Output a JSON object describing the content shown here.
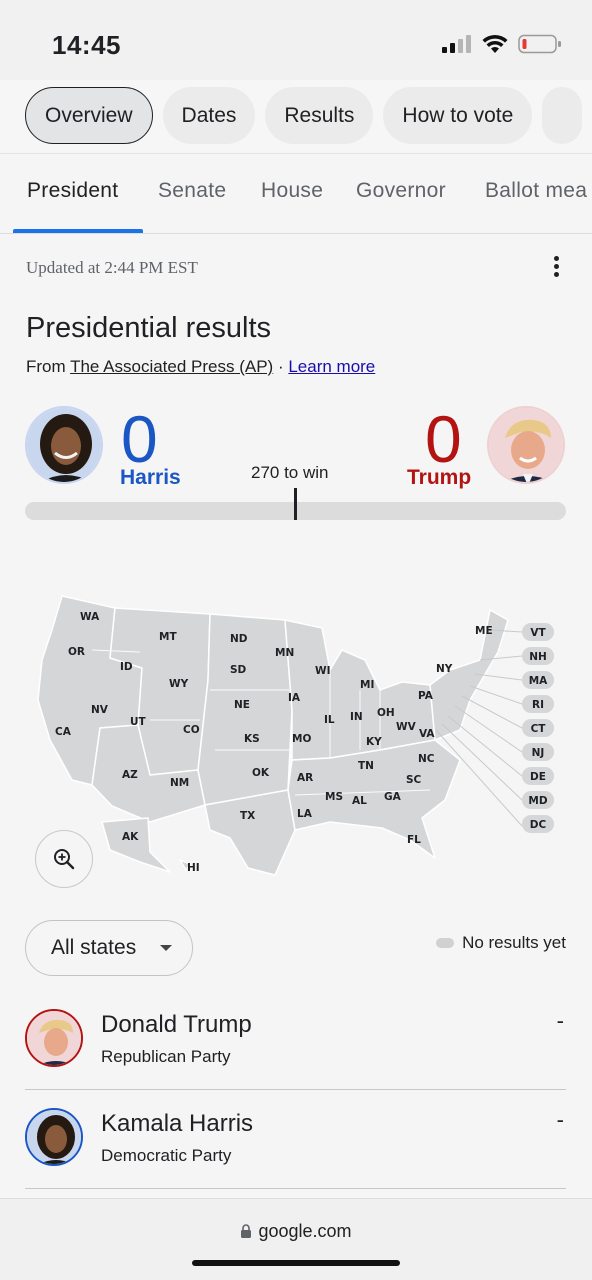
{
  "status_bar": {
    "time": "14:45"
  },
  "chips": [
    "Overview",
    "Dates",
    "Results",
    "How to vote"
  ],
  "tabs": [
    "President",
    "Senate",
    "House",
    "Governor",
    "Ballot mea"
  ],
  "updated": "Updated at 2:44 PM EST",
  "title": "Presidential results",
  "source": {
    "prefix": "From ",
    "outlet": "The Associated Press (AP)",
    "separator": " · ",
    "learn_more": "Learn more"
  },
  "candidates": {
    "left": {
      "name": "Harris",
      "votes": "0",
      "color": "#1a56c4"
    },
    "right": {
      "name": "Trump",
      "votes": "0",
      "color": "#b31412"
    }
  },
  "to_win": "270 to win",
  "map_states": {
    "WA": "WA",
    "OR": "OR",
    "CA": "CA",
    "ID": "ID",
    "NV": "NV",
    "MT": "MT",
    "WY": "WY",
    "UT": "UT",
    "AZ": "AZ",
    "CO": "CO",
    "NM": "NM",
    "ND": "ND",
    "SD": "SD",
    "NE": "NE",
    "KS": "KS",
    "OK": "OK",
    "TX": "TX",
    "MN": "MN",
    "IA": "IA",
    "MO": "MO",
    "AR": "AR",
    "LA": "LA",
    "WI": "WI",
    "IL": "IL",
    "MI": "MI",
    "IN": "IN",
    "OH": "OH",
    "KY": "KY",
    "TN": "TN",
    "MS": "MS",
    "AL": "AL",
    "GA": "GA",
    "FL": "FL",
    "SC": "SC",
    "NC": "NC",
    "VA": "VA",
    "WV": "WV",
    "PA": "PA",
    "NY": "NY",
    "ME": "ME",
    "AK": "AK",
    "HI": "HI"
  },
  "small_states": [
    "VT",
    "NH",
    "MA",
    "RI",
    "CT",
    "NJ",
    "DE",
    "MD",
    "DC"
  ],
  "filter": "All states",
  "legend": "No results yet",
  "results_list": [
    {
      "name": "Donald Trump",
      "party": "Republican Party",
      "value": "-"
    },
    {
      "name": "Kamala Harris",
      "party": "Democratic Party",
      "value": "-"
    }
  ],
  "url": "google.com"
}
